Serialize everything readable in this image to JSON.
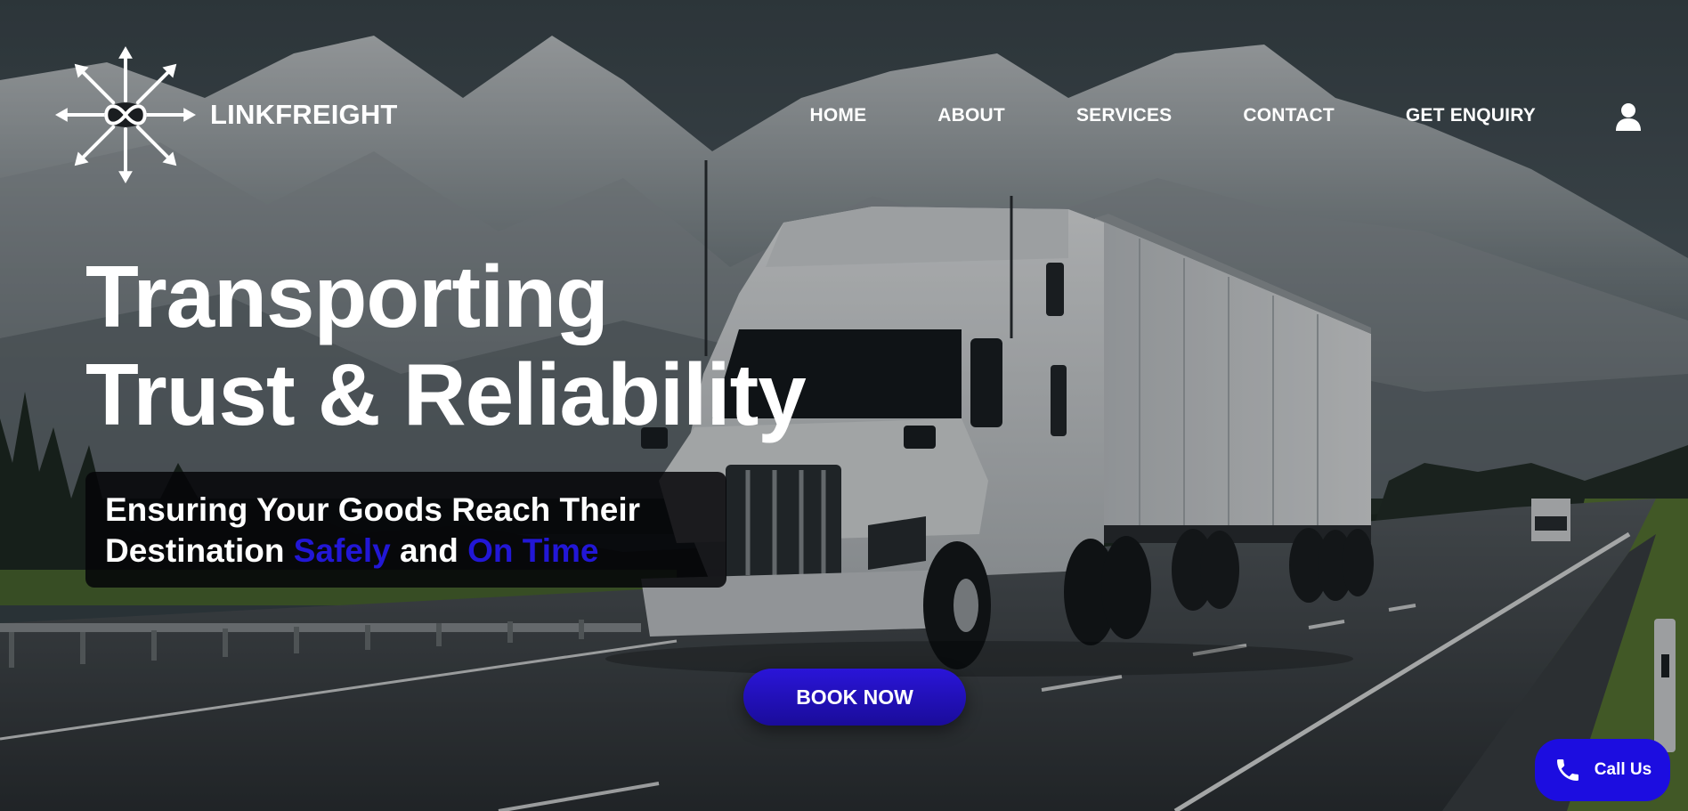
{
  "brand": {
    "name": "LINKFREIGHT",
    "logo_icon": "arrows-infinity-logo"
  },
  "nav": {
    "items": [
      {
        "label": "HOME"
      },
      {
        "label": "ABOUT"
      },
      {
        "label": "SERVICES"
      },
      {
        "label": "CONTACT"
      },
      {
        "label": "GET ENQUIRY"
      }
    ],
    "user_icon": "user-icon"
  },
  "hero": {
    "headline_line1": "Transporting",
    "headline_line2": "Trust & Reliability",
    "tagline_part1": "Ensuring Your Goods Reach Their",
    "tagline_part2": "Destination ",
    "tagline_accent1": "Safely",
    "tagline_part3": " and ",
    "tagline_accent2": "On Time",
    "book_button": "BOOK NOW",
    "background": "white semi-truck on highway with snowy mountains"
  },
  "call_button": {
    "label": "Call Us",
    "icon": "phone-icon"
  },
  "colors": {
    "accent": "#2217d6",
    "button": "#1c0de0",
    "text": "#ffffff"
  }
}
